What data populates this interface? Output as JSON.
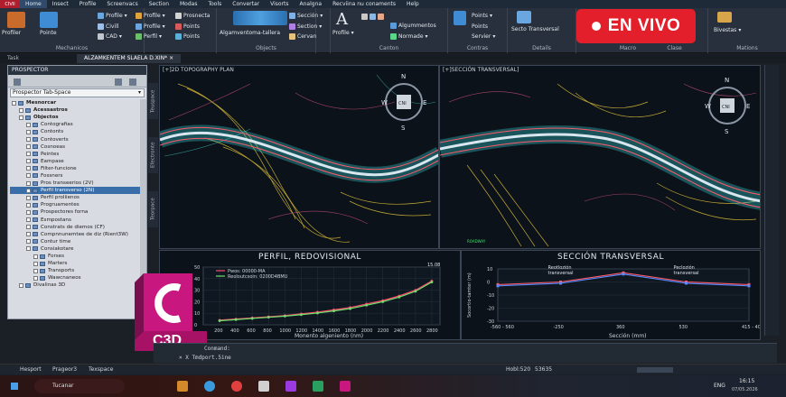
{
  "app": {
    "logo": "CIVIl"
  },
  "menu": [
    "Home",
    "Insect",
    "Profile",
    "Screenvacs",
    "Section",
    "Modas",
    "Tools",
    "Convertar",
    "Visorts",
    "Analgna",
    "Recviina nu conaments",
    "Help"
  ],
  "ribbon": {
    "groups": {
      "mechanicos": "Mechanicos",
      "objects": "Objects",
      "canton": "Canton",
      "contras": "Contras",
      "details": "Details",
      "macro": "Macro",
      "clase": "Clase",
      "mations": "Mations"
    },
    "buttons": {
      "profiler": "Profiler",
      "pointe": "Pointe",
      "profile1": "Profile",
      "civill": "Civill",
      "cad": "CAD",
      "profile2": "Profile",
      "profile3": "Profile",
      "perfil": "Perfil",
      "prosnecta": "Prosnecta",
      "points1": "Points",
      "points2": "Points",
      "alineamiento": "Algamventoma-tallera",
      "seccion1": "Sección",
      "seccion2": "Section",
      "cervan": "Cervan",
      "profile4": "Profile",
      "algumm": "Algummentos",
      "normade": "Normade",
      "points3": "Points",
      "points4": "Points",
      "servier": "Servier",
      "secto": "Secto Transversal",
      "bivestas": "Bivestas"
    }
  },
  "live_badge": "EN VIVO",
  "tabs": {
    "left": "Task",
    "active": "ALZAMKENTEM SLAELA D.XIN*",
    "close": "×"
  },
  "prospector": {
    "title": "PROSPECTOR",
    "selector": "Prospector Tab-Space",
    "tree": [
      {
        "label": "Mesnorcar",
        "level": 0,
        "bold": true
      },
      {
        "label": "Acessastros",
        "level": 1,
        "bold": true
      },
      {
        "label": "Objectos",
        "level": 1,
        "bold": true
      },
      {
        "label": "Contografias",
        "level": 2
      },
      {
        "label": "Contonts",
        "level": 2
      },
      {
        "label": "Contoverts",
        "level": 2
      },
      {
        "label": "Cosnoeas",
        "level": 2
      },
      {
        "label": "Peintes",
        "level": 2
      },
      {
        "label": "Eampase",
        "level": 2
      },
      {
        "label": "Filter-funcione",
        "level": 2
      },
      {
        "label": "Fossners",
        "level": 2
      },
      {
        "label": "Pros transeerios (2V)",
        "level": 2
      },
      {
        "label": "Perfil transverso (2N)",
        "level": 2,
        "hl": true
      },
      {
        "label": "Perfil proliienos",
        "level": 2
      },
      {
        "label": "Progruamentes",
        "level": 2
      },
      {
        "label": "Prospectores forna",
        "level": 2
      },
      {
        "label": "Esmpostans",
        "level": 2
      },
      {
        "label": "Constrats de diemos (CF)",
        "level": 2
      },
      {
        "label": "Compnnunemtee de diz (Rient3W)",
        "level": 2
      },
      {
        "label": "Contur time",
        "level": 2
      },
      {
        "label": "Consiakotare",
        "level": 2
      },
      {
        "label": "Forses",
        "level": 3
      },
      {
        "label": "Marters",
        "level": 3
      },
      {
        "label": "Transports",
        "level": 3
      },
      {
        "label": "Wawcnaneos",
        "level": 3
      },
      {
        "label": "Divalinas 3D",
        "level": 1
      }
    ]
  },
  "viewports": {
    "left_label": "[+]2D TOPOGRAPHY PLAN",
    "right_label": "[+]SECCIÓN TRANSVERSAL]",
    "side_tabs": [
      "Teuspace",
      "Efectronte",
      "Teorpace"
    ],
    "compass": {
      "n": "N",
      "s": "S",
      "e": "E",
      "w": "W",
      "center": "CNI"
    },
    "road_label": "ROADWAY"
  },
  "chart_data": [
    {
      "type": "line",
      "title": "PERFIL, REDOVISIONAL",
      "xlabel": "Monento algeniento (nm)",
      "ylabel": "",
      "categories": [
        200,
        400,
        600,
        800,
        1000,
        1200,
        1400,
        1600,
        1800,
        2000,
        2200,
        2400,
        2600,
        2800
      ],
      "ylim": [
        0,
        50
      ],
      "yticks": [
        0,
        10,
        20,
        30,
        40,
        50
      ],
      "legend": [
        "Pwos: 00000-MA",
        "Reoloutcsoin: 0200D4BMU"
      ],
      "end_label": "15.08",
      "series": [
        {
          "name": "Pwos: 00000-MA",
          "color": "#ff4a6a",
          "x": [
            200,
            400,
            600,
            800,
            1000,
            1200,
            1400,
            1600,
            1800,
            2000,
            2200,
            2400,
            2600,
            2800
          ],
          "values": [
            4,
            5,
            6,
            7,
            8,
            9.5,
            11,
            13,
            15,
            18,
            21,
            25,
            30,
            38
          ]
        },
        {
          "name": "Reoloutcsoin: 0200D4BMU",
          "color": "#6fe06f",
          "x": [
            200,
            400,
            600,
            800,
            1000,
            1200,
            1400,
            1600,
            1800,
            2000,
            2200,
            2400,
            2600,
            2800
          ],
          "values": [
            3.5,
            4.5,
            5.5,
            6.5,
            7.5,
            8.8,
            10.2,
            12,
            14,
            17,
            20,
            24,
            29,
            37
          ]
        }
      ]
    },
    {
      "type": "line",
      "title": "SECCIÓN TRANSVERSAL",
      "xlabel": "Sección (mm)",
      "ylabel": "Socortio-tamter (m)",
      "categories": [
        "-560 - 560",
        "-250",
        "360",
        "530",
        "415 - 403"
      ],
      "ylim": [
        -30,
        10
      ],
      "yticks": [
        -30,
        -20,
        -10,
        0,
        10
      ],
      "annotations": [
        {
          "text": "Reotlozión",
          "sub": "transversal",
          "at": 1
        },
        {
          "text": "Peclozión",
          "sub": "transversal",
          "at": 3
        }
      ],
      "series": [
        {
          "name": "",
          "color": "#ff5a6a",
          "x": [
            0,
            1,
            2,
            3,
            4
          ],
          "values": [
            -2,
            0,
            7,
            0,
            -2
          ]
        },
        {
          "name": "",
          "color": "#5a8cff",
          "x": [
            0,
            1,
            2,
            3,
            4
          ],
          "values": [
            -3,
            -1,
            6,
            -1,
            -3
          ]
        }
      ]
    }
  ],
  "command": {
    "line1": "Conmand:",
    "line2": "× X Tmdport.5ine"
  },
  "status": {
    "tabs": [
      "Hesport",
      "Prageor3",
      "Texspace"
    ],
    "coords": "Hobl:520",
    "scale": "53635"
  },
  "taskbar": {
    "search": "Tucanar",
    "time": "16:15",
    "date": "07/05.2026",
    "lang": "ENG"
  },
  "logo": {
    "letter": "C",
    "text": "C3D"
  }
}
